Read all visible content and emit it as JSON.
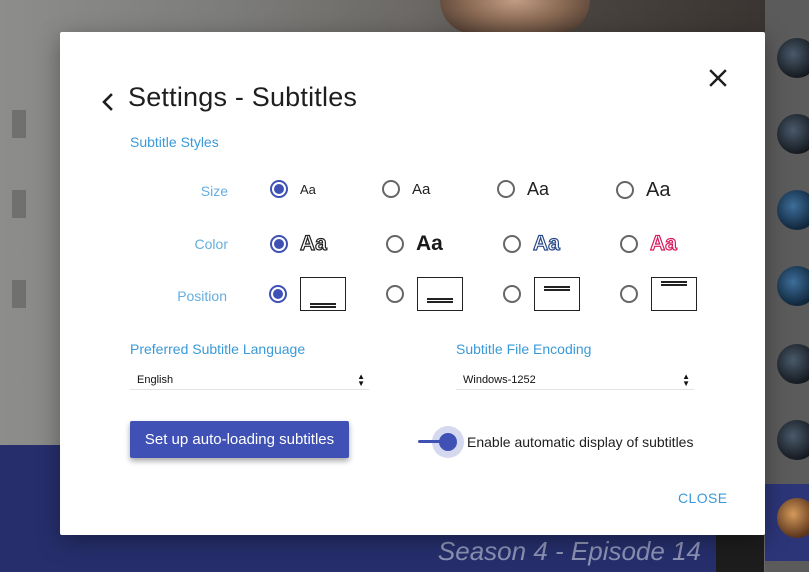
{
  "background": {
    "episode_caption": "Season 4 - Episode 14"
  },
  "dialog": {
    "title": "Settings - Subtitles",
    "section_heading": "Subtitle Styles",
    "rows": {
      "size": {
        "label": "Size",
        "selected_index": 0,
        "options": [
          "Aa",
          "Aa",
          "Aa",
          "Aa"
        ]
      },
      "color": {
        "label": "Color",
        "selected_index": 0,
        "options": [
          "Aa",
          "Aa",
          "Aa",
          "Aa"
        ],
        "styles": [
          "outline-dark",
          "solid-dark",
          "outline-blue",
          "outline-pink"
        ]
      },
      "position": {
        "label": "Position",
        "selected_index": 0,
        "options": [
          "bottom",
          "lower",
          "top",
          "upper"
        ]
      }
    },
    "language": {
      "label": "Preferred Subtitle Language",
      "value": "English"
    },
    "encoding": {
      "label": "Subtitle File Encoding",
      "value": "Windows-1252"
    },
    "autoload_button": "Set up auto-loading subtitles",
    "auto_display": {
      "label": "Enable automatic display of subtitles",
      "enabled": true
    },
    "close_label": "CLOSE"
  },
  "colors": {
    "accent": "#3f51b5",
    "link": "#3a9ad9",
    "row_label": "#64aee0",
    "banner": "#262f6c"
  }
}
